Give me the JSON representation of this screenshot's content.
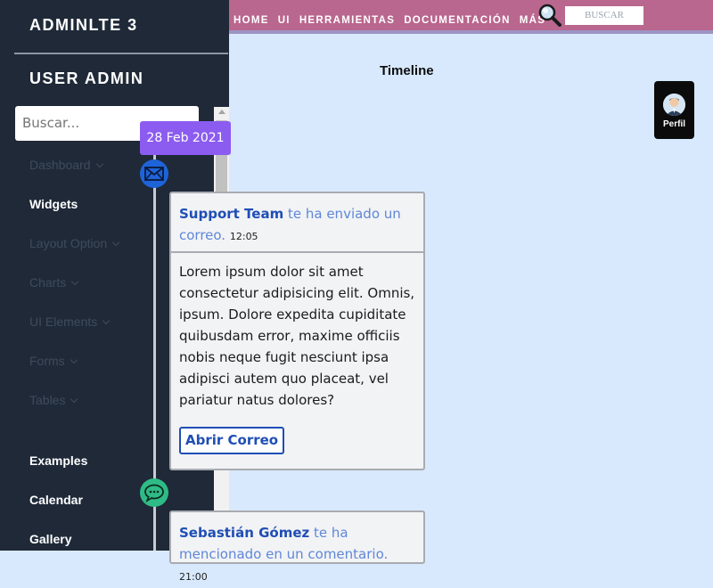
{
  "header": {
    "nav": [
      "HOME",
      "UI",
      "HERRAMIENTAS",
      "DOCUMENTACIÓN",
      "MÁS"
    ],
    "search_button": "BUSCAR"
  },
  "page": {
    "title": "Timeline"
  },
  "profile": {
    "label": "Perfil"
  },
  "sidebar": {
    "brand": "ADMINLTE 3",
    "user": "USER ADMIN",
    "search_placeholder": "Buscar...",
    "items": [
      {
        "label": "Dashboard",
        "dim": true,
        "chevron": true
      },
      {
        "label": "Widgets",
        "dim": false,
        "chevron": false
      },
      {
        "label": "Layout Option",
        "dim": true,
        "chevron": true
      },
      {
        "label": "Charts",
        "dim": true,
        "chevron": true
      },
      {
        "label": "UI Elements",
        "dim": true,
        "chevron": true
      },
      {
        "label": "Forms",
        "dim": true,
        "chevron": true
      },
      {
        "label": "Tables",
        "dim": true,
        "chevron": true
      },
      {
        "label": "Examples",
        "dim": false,
        "chevron": false
      },
      {
        "label": "Calendar",
        "dim": false,
        "chevron": false
      },
      {
        "label": "Gallery",
        "dim": false,
        "chevron": false
      }
    ]
  },
  "timeline": {
    "date": "28 Feb 2021",
    "items": [
      {
        "icon": "envelope-icon",
        "who": "Support Team",
        "action": " te ha enviado un correo.",
        "time": "12:05",
        "body": "Lorem ipsum dolor sit amet consectetur adipisicing elit. Omnis, ipsum. Dolore expedita cupiditate quibusdam error, maxime officiis nobis neque fugit nesciunt ipsa adipisci autem quo placeat, vel pariatur natus dolores?",
        "button": "Abrir Correo"
      },
      {
        "icon": "chat-bubble-icon",
        "who": "Sebastián Gómez",
        "action": " te ha mencionado en un comentario.",
        "time": "21:00"
      }
    ]
  },
  "colors": {
    "sidebar_bg": "#1f2938",
    "topbar_bg": "#b9678e",
    "page_bg": "#d9e9fd",
    "date_badge": "#8c5cf0",
    "mail_icon_bg": "#1f63d8",
    "chat_icon_bg": "#2fbb86",
    "link_blue": "#1f4eb5"
  }
}
